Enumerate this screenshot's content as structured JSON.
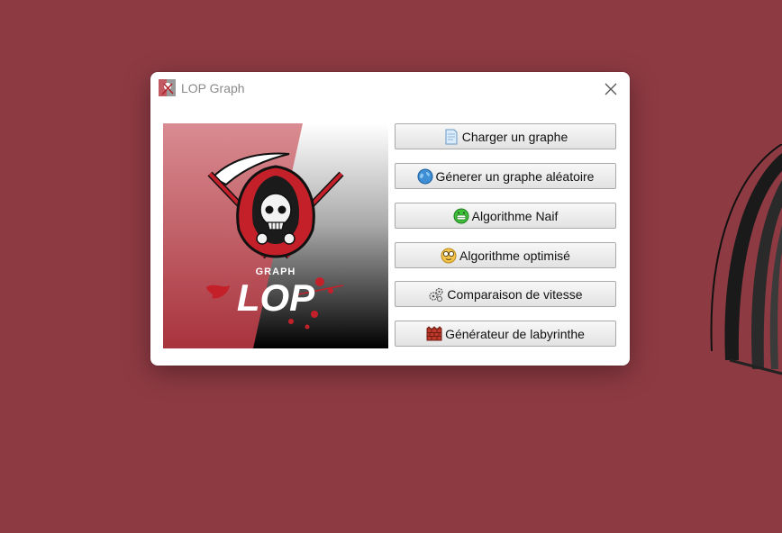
{
  "window": {
    "title": "LOP Graph"
  },
  "logo": {
    "small_text": "GRAPH",
    "big_text": "LOP"
  },
  "buttons": [
    {
      "label": "Charger un graphe",
      "icon": "document-icon"
    },
    {
      "label": "Génerer un graphe aléatoire",
      "icon": "globe-icon"
    },
    {
      "label": "Algorithme Naif",
      "icon": "grin-face-icon"
    },
    {
      "label": "Algorithme optimisé",
      "icon": "nerd-face-icon"
    },
    {
      "label": "Comparaison de vitesse",
      "icon": "gears-icon"
    },
    {
      "label": "Générateur de labyrinthe",
      "icon": "brick-wall-icon"
    }
  ],
  "colors": {
    "desktop": "#8e3a43",
    "logo_red": "#c4202a",
    "window_bg": "#ffffff"
  }
}
